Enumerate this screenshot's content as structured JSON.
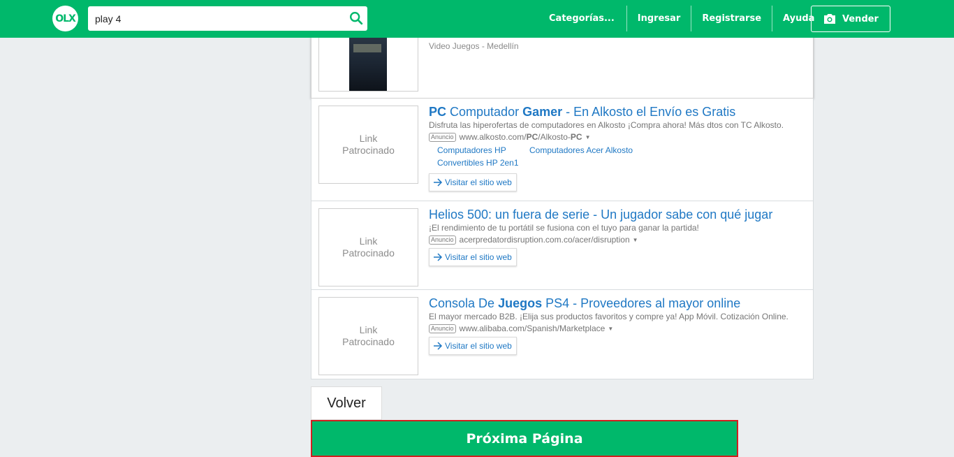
{
  "header": {
    "logo_text": "OLX",
    "search": {
      "value": "play 4"
    },
    "nav": [
      "Categorías...",
      "Ingresar",
      "Registrarse",
      "Ayuda"
    ],
    "sell_label": "Vender",
    "brand_color": "#00b86b"
  },
  "listing": {
    "meta": "Video Juegos - Medellín"
  },
  "ads": [
    {
      "thumb_label_1": "Link",
      "thumb_label_2": "Patrocinado",
      "title_parts": [
        "PC",
        " Computador ",
        "Gamer",
        " - En Alkosto el Envío es Gratis"
      ],
      "description": "Disfruta las hiperofertas de computadores en Alkosto ¡Compra ahora! Más dtos con TC Alkosto.",
      "badge": "Anuncio",
      "url_parts": [
        "www.alkosto.com/",
        "PC",
        "/Alkosto-",
        "PC"
      ],
      "sitelinks": [
        "Computadores HP",
        "Computadores Acer Alkosto",
        "Convertibles HP 2en1"
      ],
      "cta": "Visitar el sitio web"
    },
    {
      "thumb_label_1": "Link",
      "thumb_label_2": "Patrocinado",
      "title": "Helios 500: un fuera de serie - Un jugador sabe con qué jugar",
      "description": "¡El rendimiento de tu portátil se fusiona con el tuyo para ganar la partida!",
      "badge": "Anuncio",
      "url": "acerpredatordisruption.com.co/acer/disruption",
      "cta": "Visitar el sitio web"
    },
    {
      "thumb_label_1": "Link",
      "thumb_label_2": "Patrocinado",
      "title_parts": [
        "Consola De ",
        "Juegos",
        " PS4 - Proveedores al mayor online"
      ],
      "description": "El mayor mercado B2B. ¡Elija sus productos favoritos y compre ya! App Móvil. Cotización Online.",
      "badge": "Anuncio",
      "url": "www.alibaba.com/Spanish/Marketplace",
      "cta": "Visitar el sitio web"
    }
  ],
  "pagination": {
    "back_label": "Volver",
    "next_label": "Próxima Página"
  }
}
